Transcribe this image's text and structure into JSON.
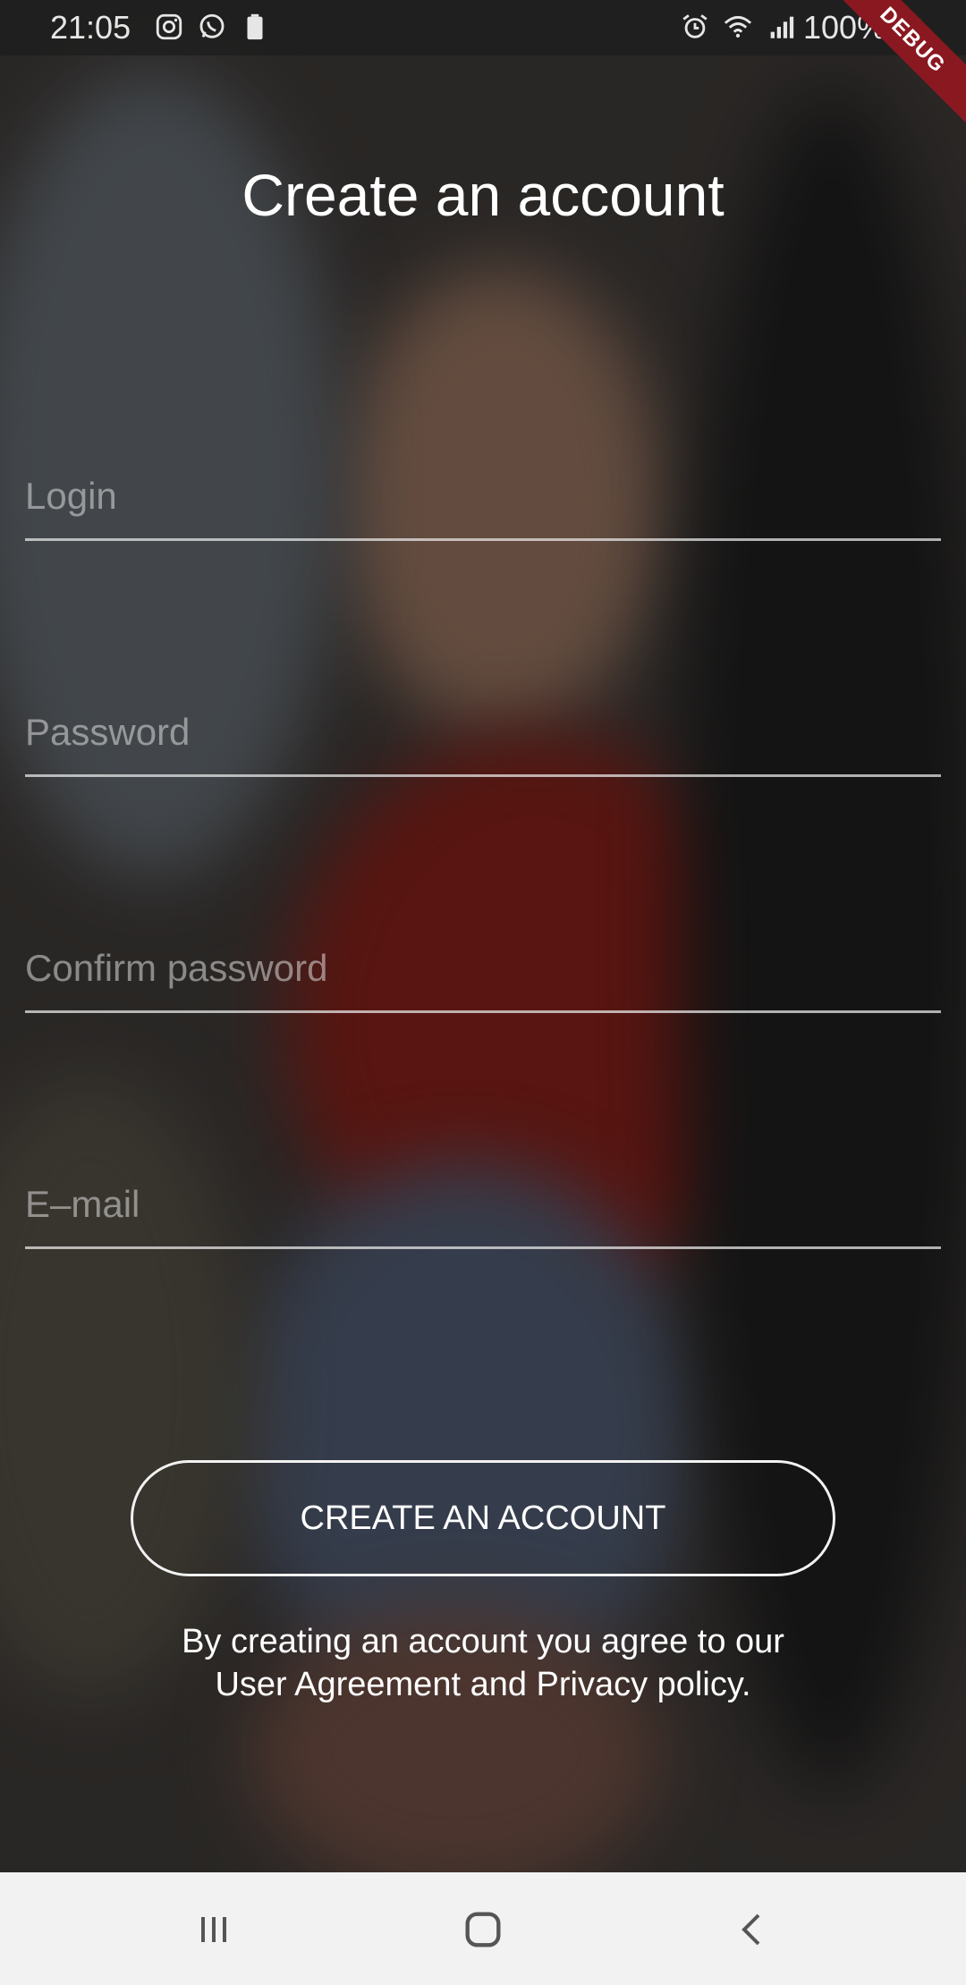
{
  "status_bar": {
    "time": "21:05",
    "battery_text": "100%",
    "debug_label": "DEBUG",
    "left_icons": [
      "instagram-icon",
      "whatsapp-icon",
      "battery-saver-icon"
    ],
    "right_icons": [
      "alarm-icon",
      "wifi-icon",
      "signal-icon",
      "battery-icon"
    ]
  },
  "page": {
    "title": "Create an account"
  },
  "form": {
    "login_placeholder": "Login",
    "password_placeholder": "Password",
    "confirm_placeholder": "Confirm password",
    "email_placeholder": "E–mail"
  },
  "actions": {
    "create_label": "CREATE AN ACCOUNT"
  },
  "footer": {
    "agreement_line1": "By creating an account you agree to our",
    "agreement_line2": "User Agreement and Privacy policy."
  },
  "nav": {
    "recents": "recents-icon",
    "home": "home-icon",
    "back": "back-icon"
  },
  "colors": {
    "ribbon": "#8a1820",
    "nav_bg": "#f2f2f2",
    "text": "#ffffff"
  }
}
